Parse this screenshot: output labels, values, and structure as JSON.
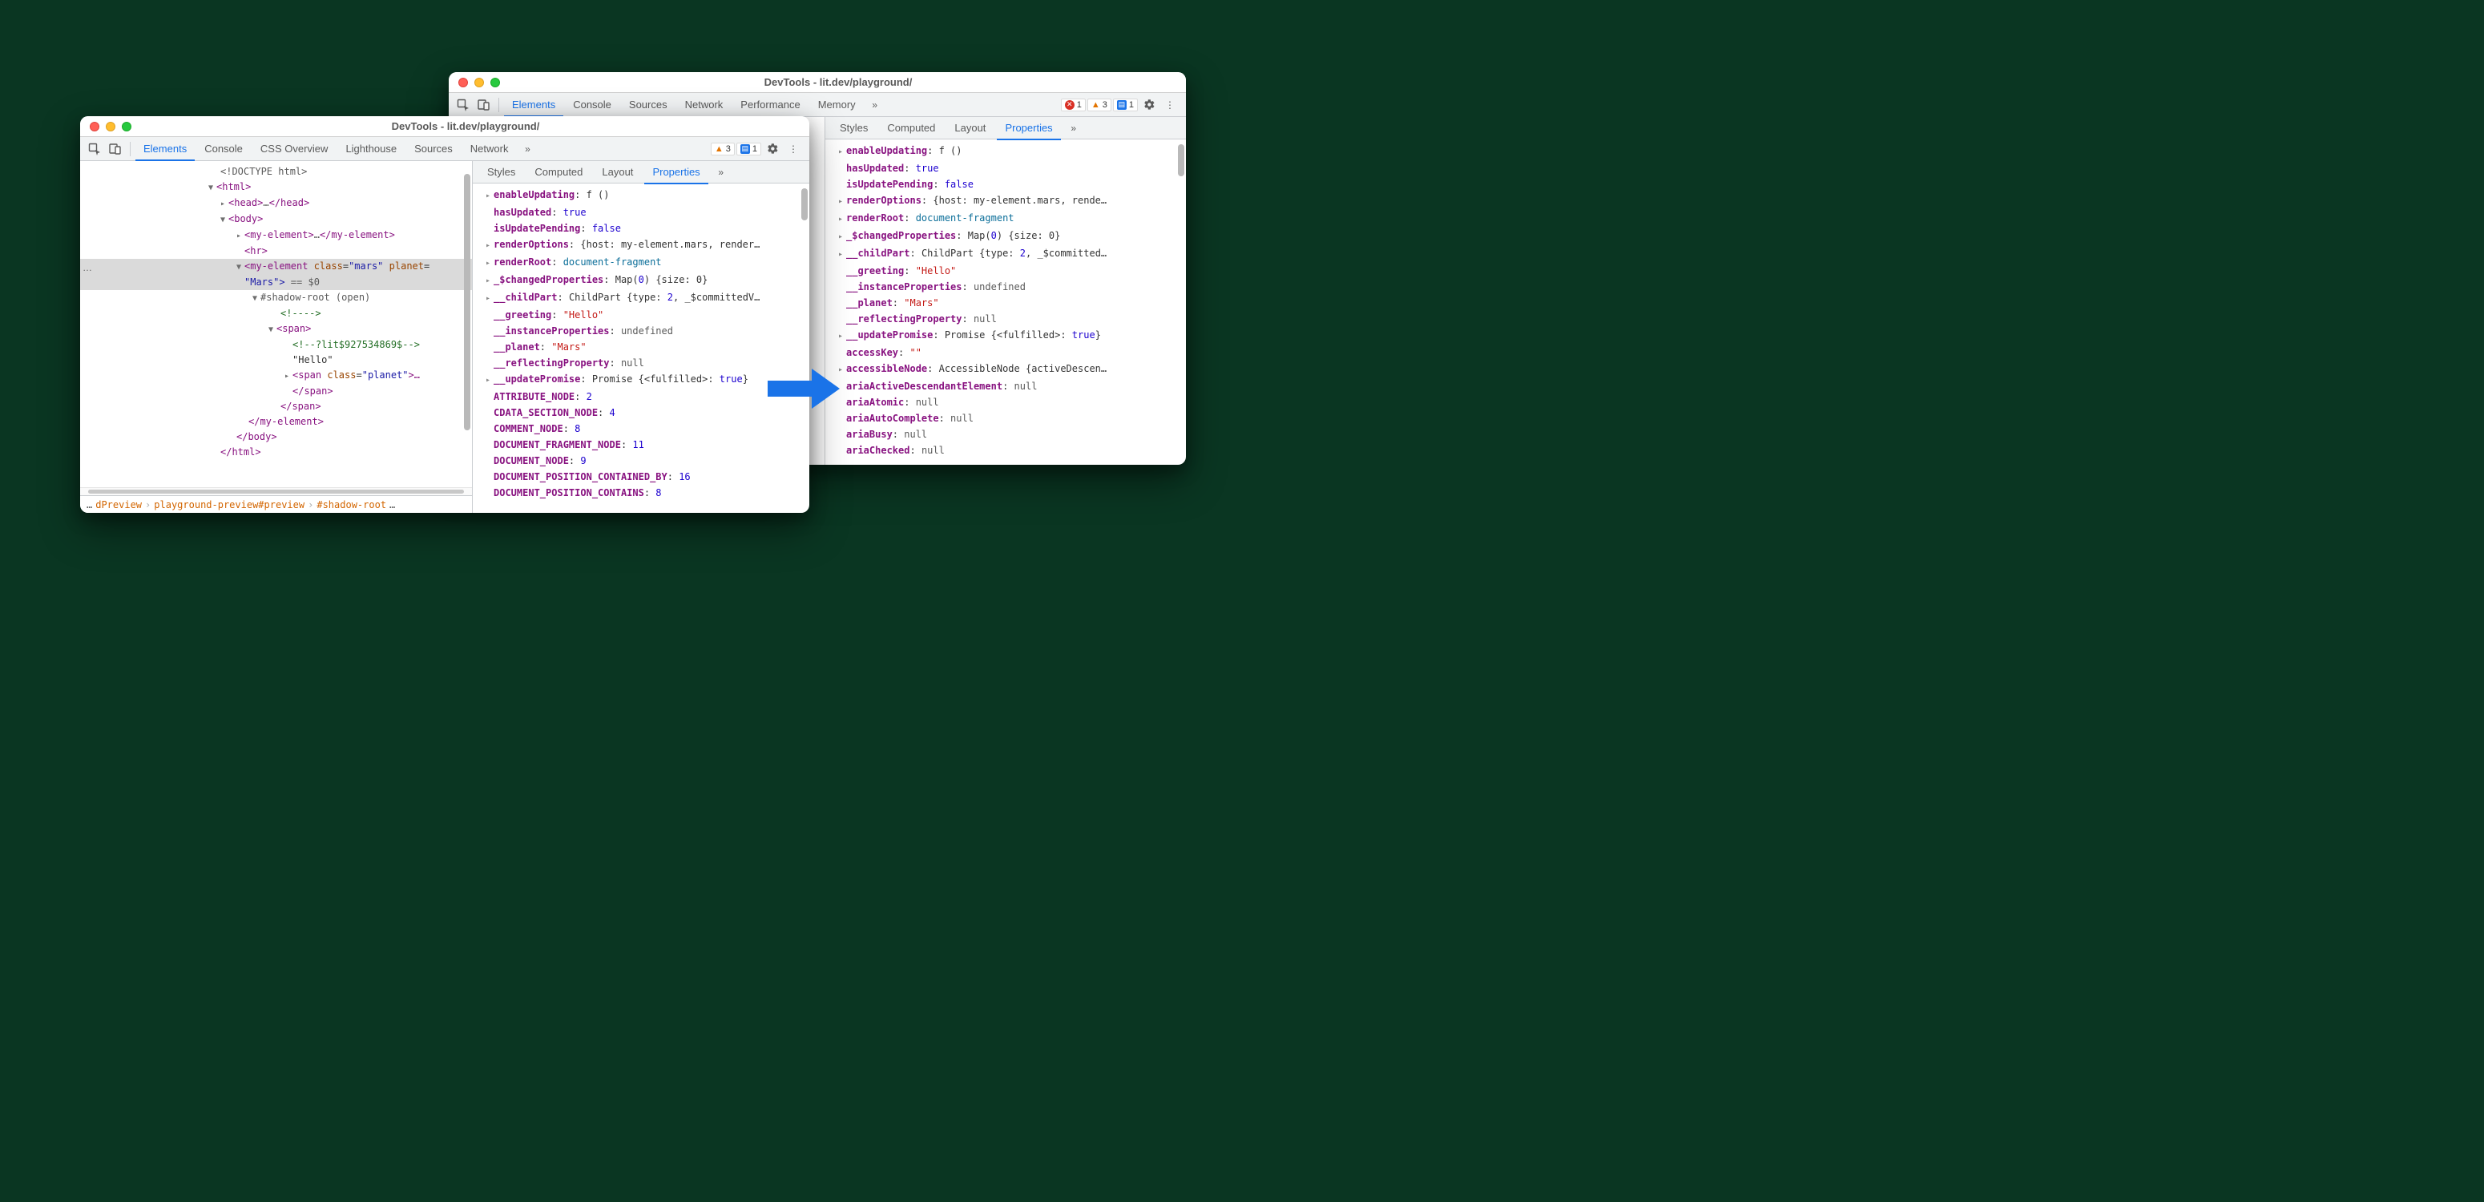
{
  "windowA": {
    "title": "DevTools - lit.dev/playground/",
    "tabs": [
      "Elements",
      "Console",
      "CSS Overview",
      "Lighthouse",
      "Sources",
      "Network"
    ],
    "activeTab": "Elements",
    "warnCount": "3",
    "issueCount": "1",
    "breadcrumb": [
      "…",
      "dPreview",
      "playground-preview#preview",
      "#shadow-root",
      "…"
    ],
    "dom": {
      "ellipsisMarker": "…",
      "selBadge": "…",
      "doctype": "<!DOCTYPE html>",
      "htmlOpen": "<html>",
      "headOpen": "<head>",
      "headEllip": "…",
      "headClose": "</head>",
      "bodyOpen": "<body>",
      "myel1Open": "<my-element>",
      "myel1Ellip": "…",
      "myel1Close": "</my-element>",
      "hr": "<hr>",
      "myel2Open": "<my-element ",
      "myel2class_n": "class",
      "myel2class_v": "\"mars\"",
      "myel2planet_n": "planet",
      "myel2Line2": "\"Mars\">",
      "eq0": " == $0",
      "shadow": "#shadow-root (open)",
      "comment1": "<!---->",
      "spanOpen": "<span>",
      "commentLit": "<!--?lit$927534869$-->",
      "hello": "\"Hello\"",
      "spanPlanetOpen": "<span ",
      "spanPlanet_n": "class",
      "spanPlanet_v": "\"planet\"",
      "spanPlanetEllip": ">…",
      "spanClose": "</span>",
      "spanClose2": "</span>",
      "myel2Close": "</my-element>",
      "bodyClose": "</body>",
      "htmlClose": "</html>"
    },
    "subTabs": [
      "Styles",
      "Computed",
      "Layout",
      "Properties"
    ],
    "activeSubTab": "Properties",
    "props": [
      {
        "exp": "▸",
        "k": "enableUpdating",
        "v": "f ()",
        "t": "obj"
      },
      {
        "exp": "",
        "k": "hasUpdated",
        "v": "true",
        "t": "kw"
      },
      {
        "exp": "",
        "k": "isUpdatePending",
        "v": "false",
        "t": "kw"
      },
      {
        "exp": "▸",
        "k": "renderOptions",
        "v": "{host: my-element.mars, render…",
        "t": "obj"
      },
      {
        "exp": "▸",
        "k": "renderRoot",
        "v": "document-fragment",
        "t": "doc"
      },
      {
        "exp": "▸",
        "k": "_$changedProperties",
        "v": "Map(0) {size: 0}",
        "t": "obj",
        "num0": "0"
      },
      {
        "exp": "▸",
        "k": "__childPart",
        "v": "ChildPart {type: 2, _$committedV…",
        "t": "obj",
        "num0": "2"
      },
      {
        "exp": "",
        "k": "__greeting",
        "v": "\"Hello\"",
        "t": "str"
      },
      {
        "exp": "",
        "k": "__instanceProperties",
        "v": "undefined",
        "t": "kw",
        "gray": true
      },
      {
        "exp": "",
        "k": "__planet",
        "v": "\"Mars\"",
        "t": "str"
      },
      {
        "exp": "",
        "k": "__reflectingProperty",
        "v": "null",
        "t": "kw",
        "gray": true
      },
      {
        "exp": "▸",
        "k": "__updatePromise",
        "v": "Promise {<fulfilled>: true}",
        "t": "obj",
        "kw": "true"
      },
      {
        "exp": "",
        "k": "ATTRIBUTE_NODE",
        "v": "2",
        "t": "num"
      },
      {
        "exp": "",
        "k": "CDATA_SECTION_NODE",
        "v": "4",
        "t": "num"
      },
      {
        "exp": "",
        "k": "COMMENT_NODE",
        "v": "8",
        "t": "num"
      },
      {
        "exp": "",
        "k": "DOCUMENT_FRAGMENT_NODE",
        "v": "11",
        "t": "num"
      },
      {
        "exp": "",
        "k": "DOCUMENT_NODE",
        "v": "9",
        "t": "num"
      },
      {
        "exp": "",
        "k": "DOCUMENT_POSITION_CONTAINED_BY",
        "v": "16",
        "t": "num"
      },
      {
        "exp": "",
        "k": "DOCUMENT_POSITION_CONTAINS",
        "v": "8",
        "t": "num"
      }
    ]
  },
  "windowB": {
    "title": "DevTools - lit.dev/playground/",
    "tabs": [
      "Elements",
      "Console",
      "Sources",
      "Network",
      "Performance",
      "Memory"
    ],
    "activeTab": "Elements",
    "errCount": "1",
    "warnCount": "3",
    "issueCount": "1",
    "subTabs": [
      "Styles",
      "Computed",
      "Layout",
      "Properties"
    ],
    "activeSubTab": "Properties",
    "props": [
      {
        "exp": "▸",
        "k": "enableUpdating",
        "v": "f ()",
        "t": "obj"
      },
      {
        "exp": "",
        "k": "hasUpdated",
        "v": "true",
        "t": "kw"
      },
      {
        "exp": "",
        "k": "isUpdatePending",
        "v": "false",
        "t": "kw"
      },
      {
        "exp": "▸",
        "k": "renderOptions",
        "v": "{host: my-element.mars, rende…",
        "t": "obj"
      },
      {
        "exp": "▸",
        "k": "renderRoot",
        "v": "document-fragment",
        "t": "doc"
      },
      {
        "exp": "▸",
        "k": "_$changedProperties",
        "v": "Map(0) {size: 0}",
        "t": "obj",
        "num0": "0"
      },
      {
        "exp": "▸",
        "k": "__childPart",
        "v": "ChildPart {type: 2, _$committed…",
        "t": "obj",
        "num0": "2"
      },
      {
        "exp": "",
        "k": "__greeting",
        "v": "\"Hello\"",
        "t": "str"
      },
      {
        "exp": "",
        "k": "__instanceProperties",
        "v": "undefined",
        "t": "kw",
        "gray": true
      },
      {
        "exp": "",
        "k": "__planet",
        "v": "\"Mars\"",
        "t": "str"
      },
      {
        "exp": "",
        "k": "__reflectingProperty",
        "v": "null",
        "t": "kw",
        "gray": true
      },
      {
        "exp": "▸",
        "k": "__updatePromise",
        "v": "Promise {<fulfilled>: true}",
        "t": "obj",
        "kw": "true"
      },
      {
        "exp": "",
        "k": "accessKey",
        "v": "\"\"",
        "t": "str"
      },
      {
        "exp": "▸",
        "k": "accessibleNode",
        "v": "AccessibleNode {activeDescen…",
        "t": "obj"
      },
      {
        "exp": "",
        "k": "ariaActiveDescendantElement",
        "v": "null",
        "t": "kw",
        "gray": true
      },
      {
        "exp": "",
        "k": "ariaAtomic",
        "v": "null",
        "t": "kw",
        "gray": true
      },
      {
        "exp": "",
        "k": "ariaAutoComplete",
        "v": "null",
        "t": "kw",
        "gray": true
      },
      {
        "exp": "",
        "k": "ariaBusy",
        "v": "null",
        "t": "kw",
        "gray": true
      },
      {
        "exp": "",
        "k": "ariaChecked",
        "v": "null",
        "t": "kw",
        "gray": true
      }
    ]
  }
}
